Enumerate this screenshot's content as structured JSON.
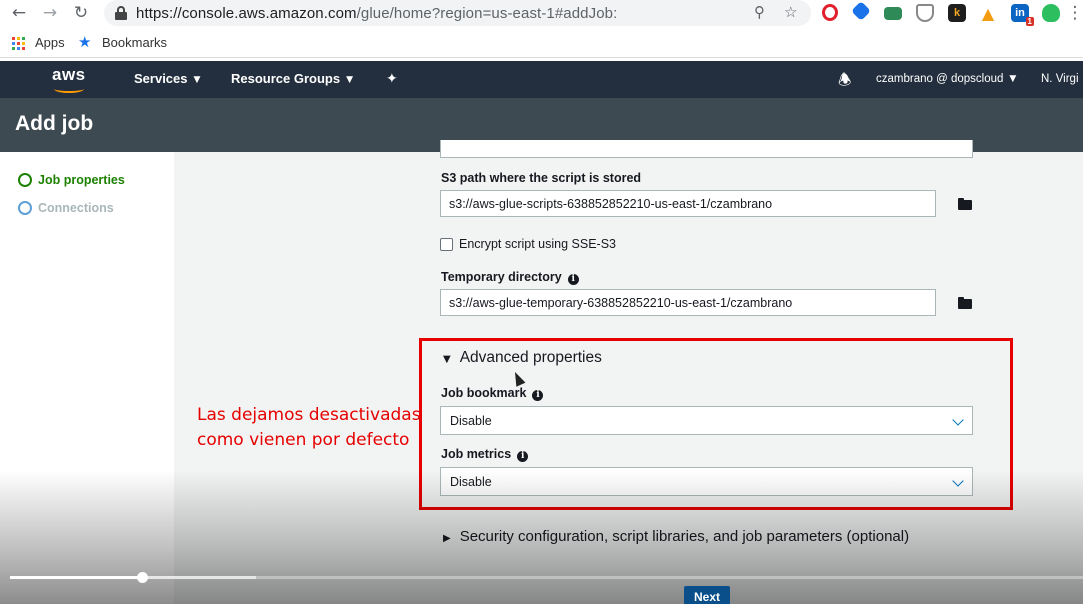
{
  "browser": {
    "url_host": "https://console.aws.amazon.com",
    "url_path": "/glue/home?region=us-east-1#addJob:",
    "extensions": [
      "opera-icon",
      "pin-icon",
      "mail-icon",
      "shield-icon",
      "k-icon",
      "warning-icon",
      "linkedin-icon",
      "evernote-icon"
    ],
    "linkedin_badge": "1"
  },
  "bookmarks": {
    "apps_label": "Apps",
    "bookmarks_label": "Bookmarks"
  },
  "aws_nav": {
    "logo": "aws",
    "services": "Services",
    "resource_groups": "Resource Groups",
    "account": "czambrano @ dopscloud",
    "region": "N. Virgi"
  },
  "page": {
    "title": "Add job"
  },
  "steps": [
    {
      "label": "Job properties",
      "color": "#1d8102"
    },
    {
      "label": "Connections",
      "color": "#aab7b8"
    }
  ],
  "form": {
    "s3_path_label": "S3 path where the script is stored",
    "s3_path_value": "s3://aws-glue-scripts-638852852210-us-east-1/czambrano",
    "encrypt_label": "Encrypt script using SSE-S3",
    "temp_dir_label": "Temporary directory",
    "temp_dir_value": "s3://aws-glue-temporary-638852852210-us-east-1/czambrano",
    "advanced_title": "Advanced properties",
    "job_bookmark_label": "Job bookmark",
    "job_bookmark_value": "Disable",
    "job_metrics_label": "Job metrics",
    "job_metrics_value": "Disable",
    "security_title": "Security configuration, script libraries, and job parameters (optional)",
    "next_label": "Next"
  },
  "annotation": {
    "line1": "Las dejamos desactivadas",
    "line2": "como vienen por defecto"
  },
  "video": {
    "played_fraction": 0.123,
    "buffered_fraction": 0.229
  },
  "colors": {
    "aws_nav": "#232f3e",
    "title_band": "#3e4a52",
    "annotation_red": "#e60000",
    "aws_orange": "#ff9900"
  }
}
